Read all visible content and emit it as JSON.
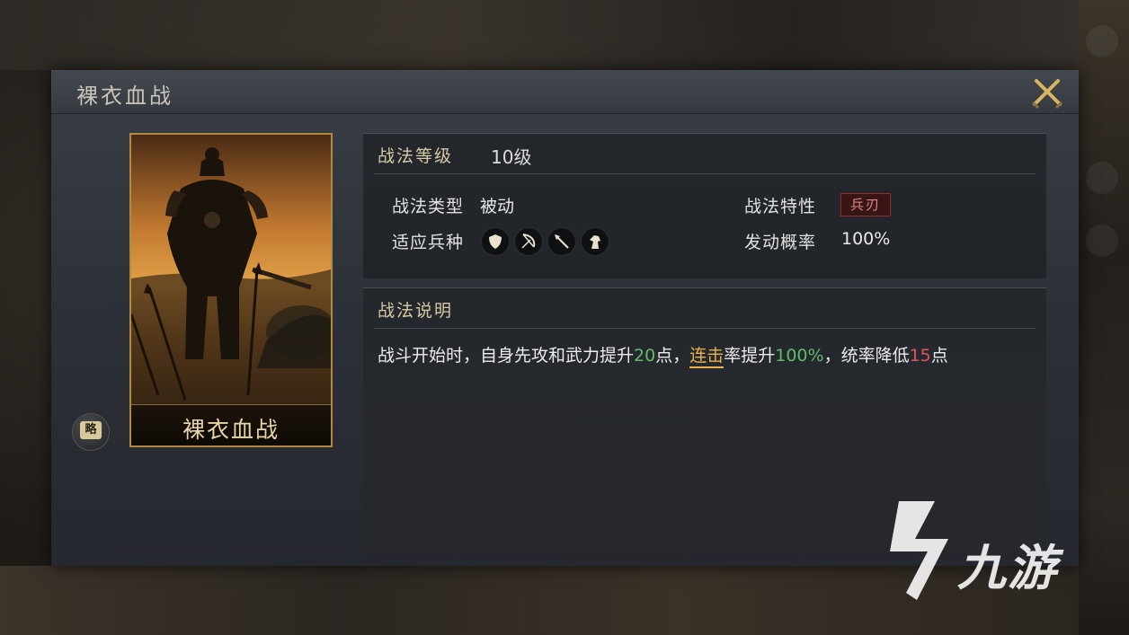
{
  "dialog": {
    "title": "裸衣血战"
  },
  "card": {
    "name": "裸衣血战"
  },
  "brief_button": {
    "label": "略"
  },
  "skill_info": {
    "level_label": "战法等级",
    "level_value": "10级",
    "type_label": "战法类型",
    "type_value": "被动",
    "trait_label": "战法特性",
    "trait_value": "兵刃",
    "units_label": "适应兵种",
    "units": [
      "shield-icon",
      "bow-icon",
      "spear-icon",
      "horse-icon"
    ],
    "rate_label": "发动概率",
    "rate_value": "100%"
  },
  "description": {
    "heading": "战法说明",
    "part1": "战斗开始时，自身先攻和武力提升",
    "num1": "20",
    "part2": "点，",
    "keyword": "连击",
    "part3": "率提升",
    "num2": "100%",
    "part4": "，统率降低",
    "num3": "15",
    "part5": "点"
  },
  "watermark": {
    "text": "九游"
  },
  "colors": {
    "accent_gold": "#e7b34a",
    "positive_green": "#5fbd6a",
    "negative_red": "#e0555a",
    "trait_red": "#8e2d2d"
  }
}
